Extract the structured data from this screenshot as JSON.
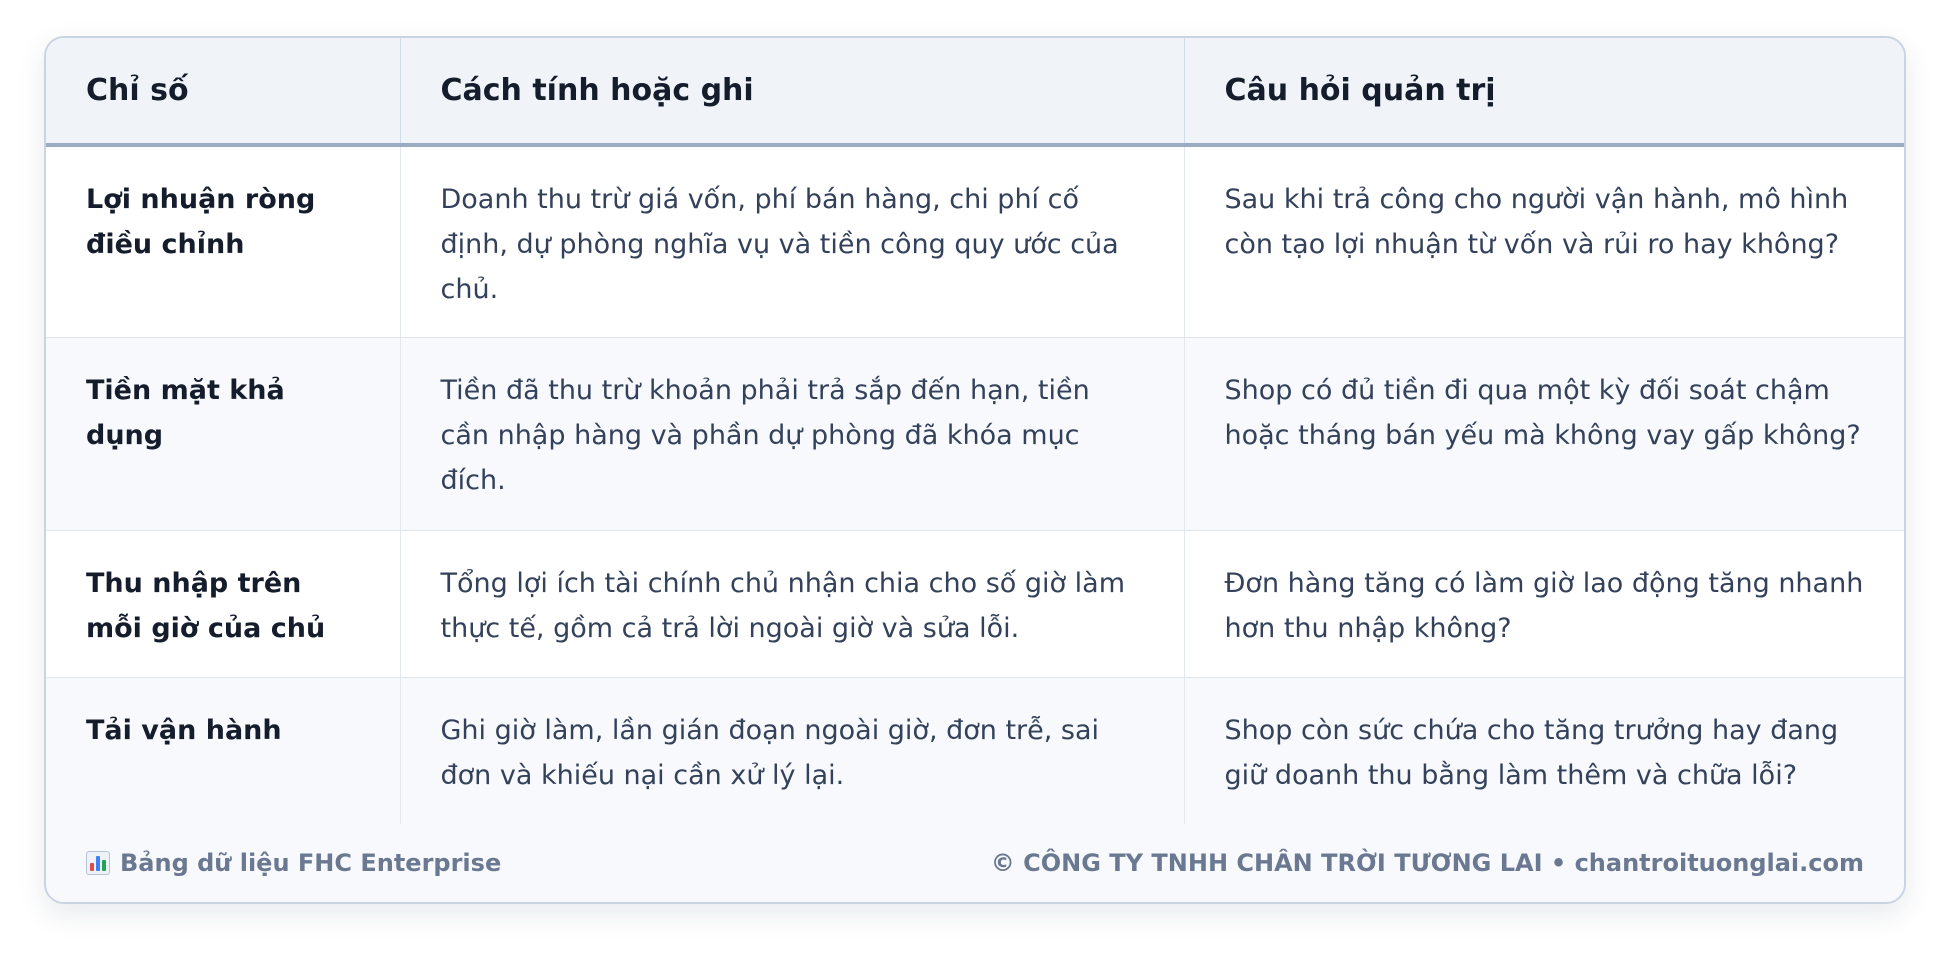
{
  "table": {
    "headers": [
      "Chỉ số",
      "Cách tính hoặc ghi",
      "Câu hỏi quản trị"
    ],
    "rows": [
      {
        "metric": "Lợi nhuận ròng điều chỉnh",
        "method": "Doanh thu trừ giá vốn, phí bán hàng, chi phí cố định, dự phòng nghĩa vụ và tiền công quy ước của chủ.",
        "question": "Sau khi trả công cho người vận hành, mô hình còn tạo lợi nhuận từ vốn và rủi ro hay không?"
      },
      {
        "metric": "Tiền mặt khả dụng",
        "method": "Tiền đã thu trừ khoản phải trả sắp đến hạn, tiền cần nhập hàng và phần dự phòng đã khóa mục đích.",
        "question": "Shop có đủ tiền đi qua một kỳ đối soát chậm hoặc tháng bán yếu mà không vay gấp không?"
      },
      {
        "metric": "Thu nhập trên mỗi giờ của chủ",
        "method": "Tổng lợi ích tài chính chủ nhận chia cho số giờ làm thực tế, gồm cả trả lời ngoài giờ và sửa lỗi.",
        "question": "Đơn hàng tăng có làm giờ lao động tăng nhanh hơn thu nhập không?"
      },
      {
        "metric": "Tải vận hành",
        "method": "Ghi giờ làm, lần gián đoạn ngoài giờ, đơn trễ, sai đơn và khiếu nại cần xử lý lại.",
        "question": "Shop còn sức chứa cho tăng trưởng hay đang giữ doanh thu bằng làm thêm và chữa lỗi?"
      }
    ]
  },
  "footer": {
    "icon": "bar-chart-icon",
    "left_text": "Bảng dữ liệu FHC Enterprise",
    "right_text": "© CÔNG TY TNHH CHÂN TRỜI TƯƠNG LAI • chantroituonglai.com"
  },
  "colors": {
    "header_bg": "#f0f4f9",
    "header_rule": "#9aabc4",
    "alt_row_bg": "#f7f9fc",
    "heading_text": "#151d2d",
    "body_text": "#33415a",
    "footer_text": "#6a7991"
  }
}
